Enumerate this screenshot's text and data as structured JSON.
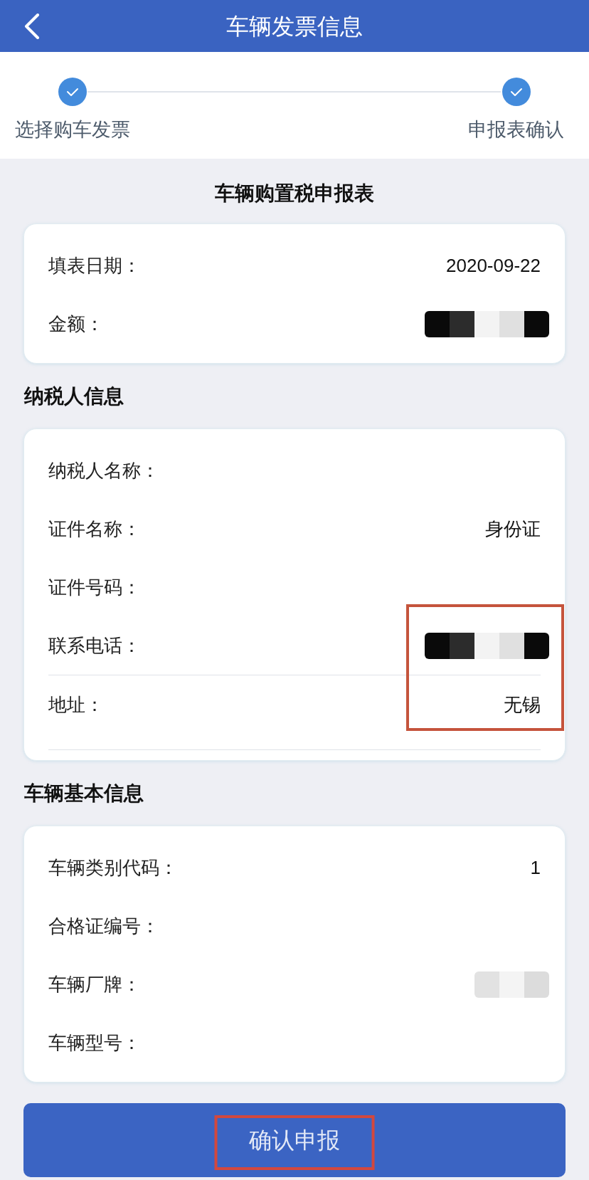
{
  "header": {
    "title": "车辆发票信息"
  },
  "steps": [
    {
      "label": "选择购车发票",
      "done": true
    },
    {
      "label": "申报表确认",
      "done": true
    }
  ],
  "form_title": "车辆购置税申报表",
  "sections": [
    {
      "rows": [
        {
          "kind": "text",
          "label": "填表日期：",
          "value": "2020-09-22",
          "highlighted": false,
          "divider_below": false
        },
        {
          "kind": "mosaic",
          "label": "金额：",
          "highlighted": false,
          "divider_below": false
        }
      ]
    },
    {
      "heading": "纳税人信息",
      "rows": [
        {
          "kind": "text",
          "label": "纳税人名称：",
          "highlighted": false,
          "divider_below": false
        },
        {
          "kind": "text",
          "label": "证件名称：",
          "value": "身份证",
          "highlighted": false,
          "divider_below": false
        },
        {
          "kind": "text",
          "label": "证件号码：",
          "highlighted": false,
          "divider_below": false
        },
        {
          "kind": "mosaic",
          "label": "联系电话：",
          "highlighted": true,
          "divider_below": true
        },
        {
          "kind": "text",
          "label": "地址：",
          "value": "无锡",
          "highlighted": true,
          "divider_below": true
        }
      ]
    },
    {
      "heading": "车辆基本信息",
      "rows": [
        {
          "kind": "text",
          "label": "车辆类别代码：",
          "value": "1",
          "highlighted": false,
          "divider_below": false
        },
        {
          "kind": "text",
          "label": "合格证编号：",
          "highlighted": false,
          "divider_below": false
        },
        {
          "kind": "faint",
          "label": "车辆厂牌：",
          "highlighted": false,
          "divider_below": false
        },
        {
          "kind": "text",
          "label": "车辆型号：",
          "highlighted": false,
          "divider_below": false
        }
      ]
    }
  ],
  "submit_button": {
    "label": "确认申报",
    "highlighted": true
  }
}
